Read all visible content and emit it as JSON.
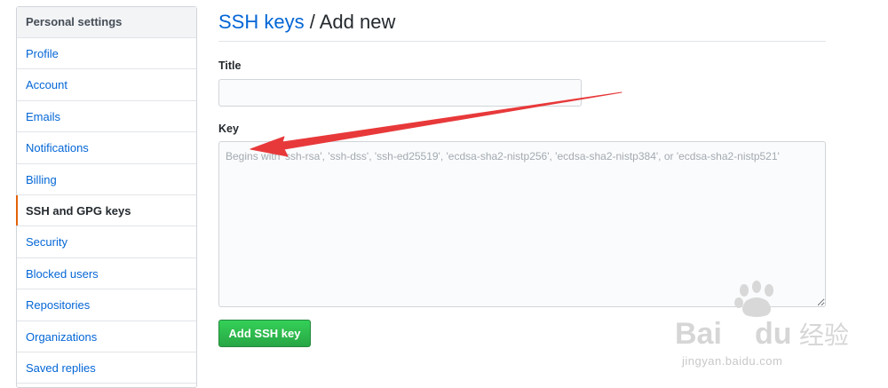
{
  "sidebar": {
    "header": "Personal settings",
    "items": [
      {
        "label": "Profile"
      },
      {
        "label": "Account"
      },
      {
        "label": "Emails"
      },
      {
        "label": "Notifications"
      },
      {
        "label": "Billing"
      },
      {
        "label": "SSH and GPG keys",
        "selected": true
      },
      {
        "label": "Security"
      },
      {
        "label": "Blocked users"
      },
      {
        "label": "Repositories"
      },
      {
        "label": "Organizations"
      },
      {
        "label": "Saved replies"
      }
    ]
  },
  "main": {
    "breadcrumb_link": "SSH keys",
    "breadcrumb_separator": " / ",
    "breadcrumb_current": "Add new",
    "title_label": "Title",
    "title_value": "",
    "key_label": "Key",
    "key_value": "",
    "key_placeholder": "Begins with 'ssh-rsa', 'ssh-dss', 'ssh-ed25519', 'ecdsa-sha2-nistp256', 'ecdsa-sha2-nistp384', or 'ecdsa-sha2-nistp521'",
    "submit_label": "Add SSH key"
  },
  "watermark": {
    "brand": "Baidu经验",
    "url": "jingyan.baidu.com"
  },
  "colors": {
    "link": "#0366d6",
    "selected_indicator": "#e36209",
    "button_green": "#28a745",
    "annotation_arrow": "#e8393a"
  }
}
